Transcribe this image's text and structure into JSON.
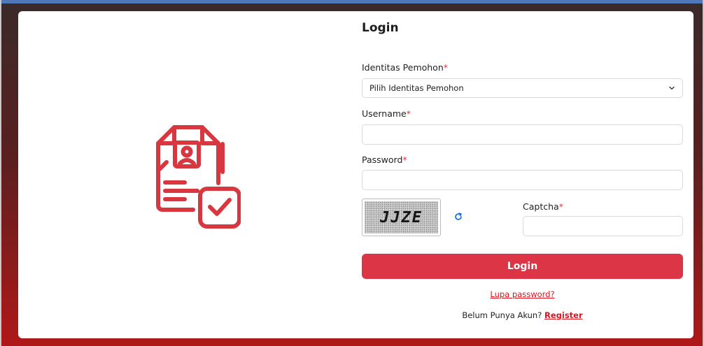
{
  "form": {
    "title": "Login",
    "identity_label": "Identitas Pemohon",
    "identity_selected": "Pilih Identitas Pemohon",
    "username_label": "Username",
    "password_label": "Password",
    "required_mark": "*",
    "captcha_code": "JJZE",
    "captcha_label": "Captcha",
    "login_button": "Login",
    "forgot_link": "Lupa password?",
    "no_account_text": "Belum Punya Akun?",
    "register_link": "Register"
  },
  "icons": {
    "illustration": "document-profile-check-icon",
    "select_chevron": "chevron-down-icon",
    "refresh_captcha": "refresh-icon"
  },
  "colors": {
    "accent": "#dc3545",
    "link": "#e0101a",
    "illustration": "#d9373f"
  }
}
